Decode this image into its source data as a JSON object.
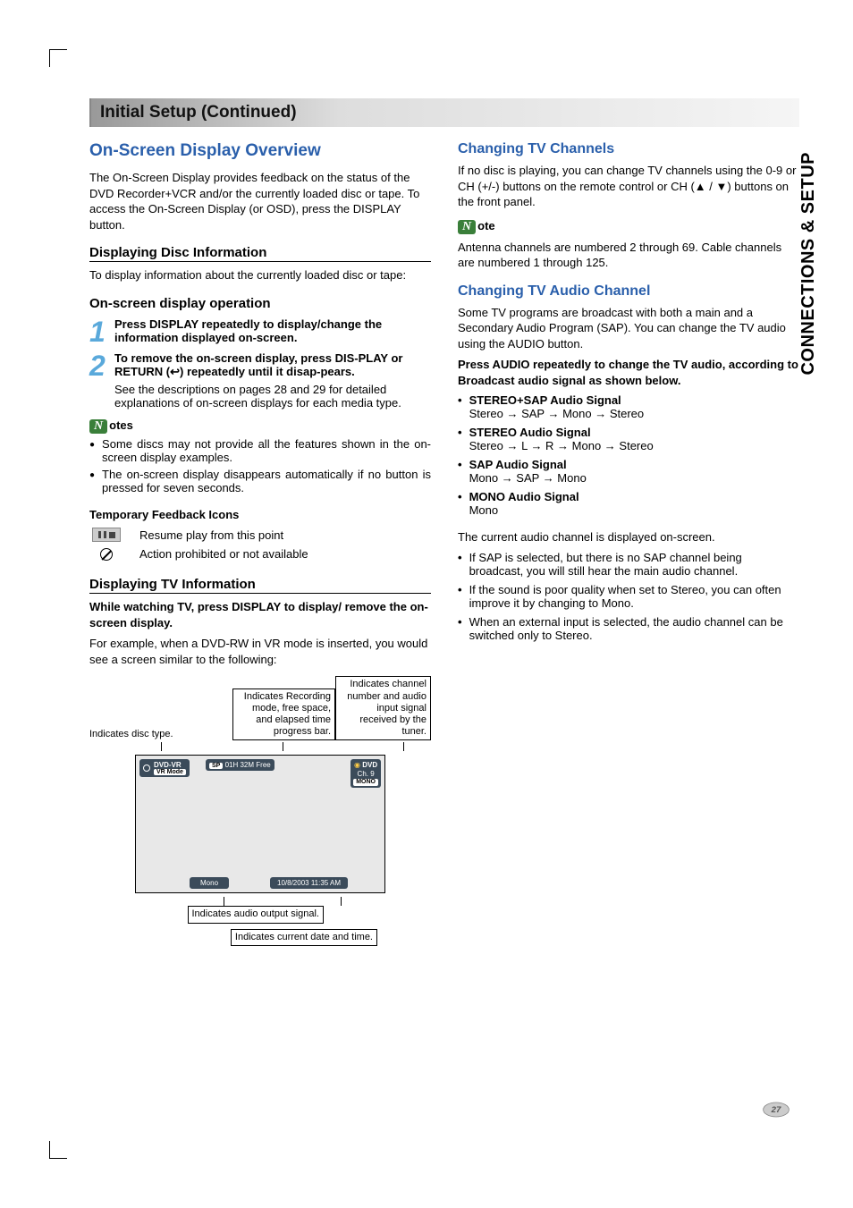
{
  "sidetab": "CONNECTIONS & SETUP",
  "pageNumber": "27",
  "banner": "Initial Setup (Continued)",
  "left": {
    "h1": "On-Screen Display Overview",
    "intro": "The On-Screen Display provides feedback on the status of the DVD Recorder+VCR and/or the currently loaded disc or tape. To access the On-Screen Display (or OSD), press the DISPLAY button.",
    "h3a": "Displaying Disc Information",
    "pa": "To display information about the currently loaded disc or tape:",
    "h3b": "On-screen display operation",
    "step1": "Press DISPLAY repeatedly to display/change the information displayed on-screen.",
    "step2a": "To remove the on-screen display, press DIS-PLAY or RETURN (↩) repeatedly until it disap-pears.",
    "step2b": "See the descriptions on pages 28 and 29 for detailed explanations of on-screen displays for each media type.",
    "notesLabel": "otes",
    "notes": [
      "Some discs may not provide all the features shown in the on-screen display examples.",
      "The on-screen display disappears automatically if no button is pressed for seven seconds."
    ],
    "tfiHeader": "Temporary Feedback Icons",
    "resume": "Resume play from this point",
    "prohibited": "Action prohibited or not available",
    "h3c": "Displaying TV Information",
    "pc_bold": "While watching TV, press DISPLAY to display/ remove the on-screen display.",
    "pc2": "For example, when a DVD-RW in VR mode is inserted, you would see a screen similar to the following:",
    "diag": {
      "discType": "Indicates disc type.",
      "recMode": "Indicates Recording mode, free space, and elapsed time progress bar.",
      "channel": "Indicates channel number and audio input signal received by the tuner.",
      "audioOut": "Indicates audio output signal.",
      "dateTime": "Indicates current date and time.",
      "osd": {
        "dvd_vr": "DVD-VR",
        "vrmode": "VR Mode",
        "sp": "SP",
        "free": "01H 32M Free",
        "dvd": "DVD",
        "ch": "Ch. 9",
        "mono_top": "MONO",
        "mono": "Mono",
        "datetime": "10/8/2003 11:35 AM"
      }
    }
  },
  "right": {
    "h2a": "Changing TV Channels",
    "p1": "If no disc is playing, you can change TV channels using the 0-9 or CH (+/-) buttons on the remote control or CH (▲ / ▼) buttons on the front panel.",
    "noteLabel": "ote",
    "note": "Antenna channels are numbered 2 through 69. Cable channels are numbered 1 through 125.",
    "h2b": "Changing TV Audio Channel",
    "p2": "Some TV programs are broadcast with both a main and a Secondary Audio Program (SAP). You can change the TV audio using the AUDIO button.",
    "p3": "Press AUDIO repeatedly to change the TV audio, according to Broadcast audio signal as shown below.",
    "signals": [
      {
        "title": "STEREO+SAP Audio Signal",
        "seq": "Stereo → SAP → Mono → Stereo"
      },
      {
        "title": "STEREO Audio Signal",
        "seq": "Stereo → L → R → Mono → Stereo"
      },
      {
        "title": "SAP Audio Signal",
        "seq": "Mono → SAP → Mono"
      },
      {
        "title": "MONO Audio Signal",
        "seq": "Mono"
      }
    ],
    "p4": "The current audio channel is displayed on-screen.",
    "bullets": [
      "If SAP is selected, but there is no SAP channel being broadcast, you will still hear the main audio channel.",
      "If the sound is poor quality when set to Stereo, you can often improve it by changing to Mono.",
      "When an external input is selected, the audio channel can be switched only to Stereo."
    ]
  }
}
